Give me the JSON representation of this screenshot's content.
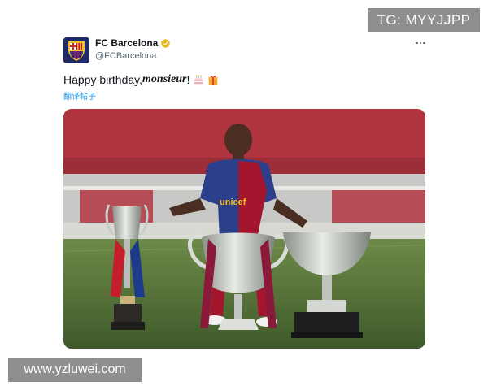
{
  "watermarks": {
    "top_right": "TG: MYYJJPP",
    "bottom_left": "www.yzluwei.com"
  },
  "post": {
    "author": {
      "display_name": "FC Barcelona",
      "handle": "@FCBarcelona",
      "verified": true,
      "avatar_icon": "fc-barcelona-crest-icon"
    },
    "text": {
      "before": "Happy birthday, ",
      "emphasis": "monsieur",
      "after": "!",
      "emojis": [
        "cake-emoji",
        "gift-emoji"
      ]
    },
    "translate_label": "翻译帖子",
    "more_icon": "more-icon",
    "media": {
      "jersey_text": "unicef"
    }
  },
  "colors": {
    "link": "#1d9bf0",
    "verified_badge": "#e2b719",
    "secondary_text": "#536471"
  }
}
